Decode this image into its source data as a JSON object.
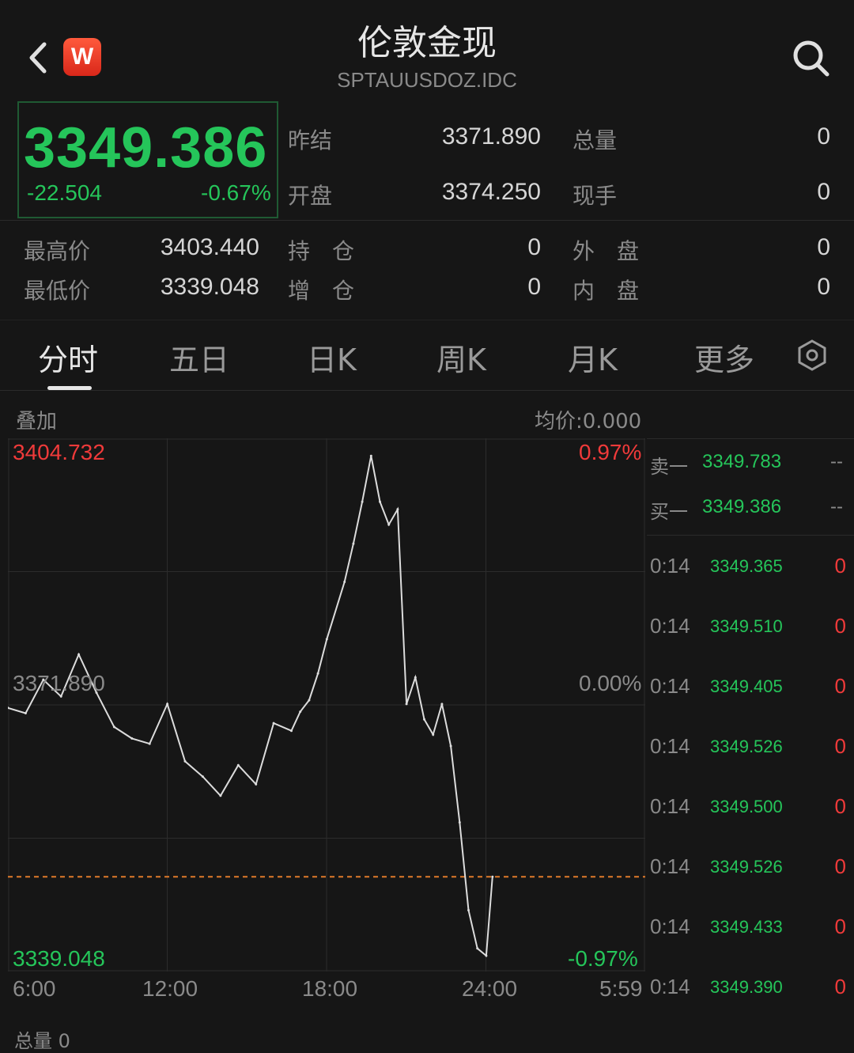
{
  "header": {
    "title": "伦敦金现",
    "subtitle": "SPTAUUSDOZ.IDC",
    "logo_letter": "W"
  },
  "quote": {
    "price": "3349.386",
    "change": "-22.504",
    "change_pct": "-0.67%",
    "stats": [
      {
        "label": "昨结",
        "value": "3371.890"
      },
      {
        "label": "开盘",
        "value": "3374.250"
      },
      {
        "label": "总量",
        "value": "0"
      },
      {
        "label": "现手",
        "value": "0"
      },
      {
        "label": "最高价",
        "value": "3403.440"
      },
      {
        "label": "最低价",
        "value": "3339.048"
      },
      {
        "label": "持　仓",
        "value": "0"
      },
      {
        "label": "增　仓",
        "value": "0"
      },
      {
        "label": "外　盘",
        "value": "0"
      },
      {
        "label": "内　盘",
        "value": "0"
      }
    ]
  },
  "tabs": [
    {
      "label": "分时"
    },
    {
      "label": "五日"
    },
    {
      "label": "日K"
    },
    {
      "label": "周K"
    },
    {
      "label": "月K"
    },
    {
      "label": "更多"
    }
  ],
  "chart_labels": {
    "overlay": "叠加",
    "avg_price": "均价:0.000",
    "y_max": "3404.732",
    "y_min": "3339.048",
    "y_mid": "3371.890",
    "pct_max": "0.97%",
    "pct_mid": "0.00%",
    "pct_min": "-0.97%",
    "times": [
      "6:00",
      "12:00",
      "18:00",
      "24:00",
      "5:59"
    ],
    "volume_label": "总量 0"
  },
  "chart_data": {
    "type": "line",
    "x": [
      "6:00",
      "6:40",
      "7:20",
      "8:00",
      "8:40",
      "9:20",
      "10:00",
      "10:40",
      "11:20",
      "12:00",
      "12:40",
      "13:20",
      "14:00",
      "14:40",
      "15:20",
      "16:00",
      "16:40",
      "17:00",
      "17:20",
      "17:40",
      "18:00",
      "18:40",
      "19:00",
      "19:20",
      "19:40",
      "20:00",
      "20:20",
      "20:40",
      "21:00",
      "21:20",
      "21:40",
      "22:00",
      "22:20",
      "22:40",
      "23:00",
      "23:20",
      "23:40",
      "24:00",
      "0:14"
    ],
    "y": [
      3371.5,
      3370.8,
      3375.2,
      3373.0,
      3378.5,
      3373.5,
      3369.0,
      3367.5,
      3366.8,
      3372.0,
      3364.5,
      3362.5,
      3360.0,
      3364.0,
      3361.5,
      3369.5,
      3368.5,
      3371.0,
      3372.5,
      3376.0,
      3380.5,
      3388.0,
      3393.0,
      3398.5,
      3404.5,
      3398.5,
      3395.5,
      3397.5,
      3372.0,
      3375.5,
      3370.0,
      3368.0,
      3372.0,
      3366.5,
      3356.5,
      3345.0,
      3340.0,
      3339.048,
      3349.386
    ],
    "prev_close": 3371.89,
    "current": 3349.386,
    "ylim": [
      3339.048,
      3404.732
    ],
    "series": [
      {
        "name": "price",
        "color": "#dcdcdc"
      }
    ]
  },
  "orderbook": {
    "ask": {
      "label": "卖一",
      "price": "3349.783",
      "vol": "--"
    },
    "bid": {
      "label": "买一",
      "price": "3349.386",
      "vol": "--"
    }
  },
  "ticks": [
    {
      "time": "0:14",
      "price": "3349.365",
      "vol": "0"
    },
    {
      "time": "0:14",
      "price": "3349.510",
      "vol": "0"
    },
    {
      "time": "0:14",
      "price": "3349.405",
      "vol": "0"
    },
    {
      "time": "0:14",
      "price": "3349.526",
      "vol": "0"
    },
    {
      "time": "0:14",
      "price": "3349.500",
      "vol": "0"
    },
    {
      "time": "0:14",
      "price": "3349.526",
      "vol": "0"
    },
    {
      "time": "0:14",
      "price": "3349.433",
      "vol": "0"
    },
    {
      "time": "0:14",
      "price": "3349.390",
      "vol": "0"
    }
  ],
  "colors": {
    "up": "#f03a3a",
    "down": "#25c55a",
    "ref_line": "#e07a2a",
    "grid": "#2c2c2c"
  }
}
